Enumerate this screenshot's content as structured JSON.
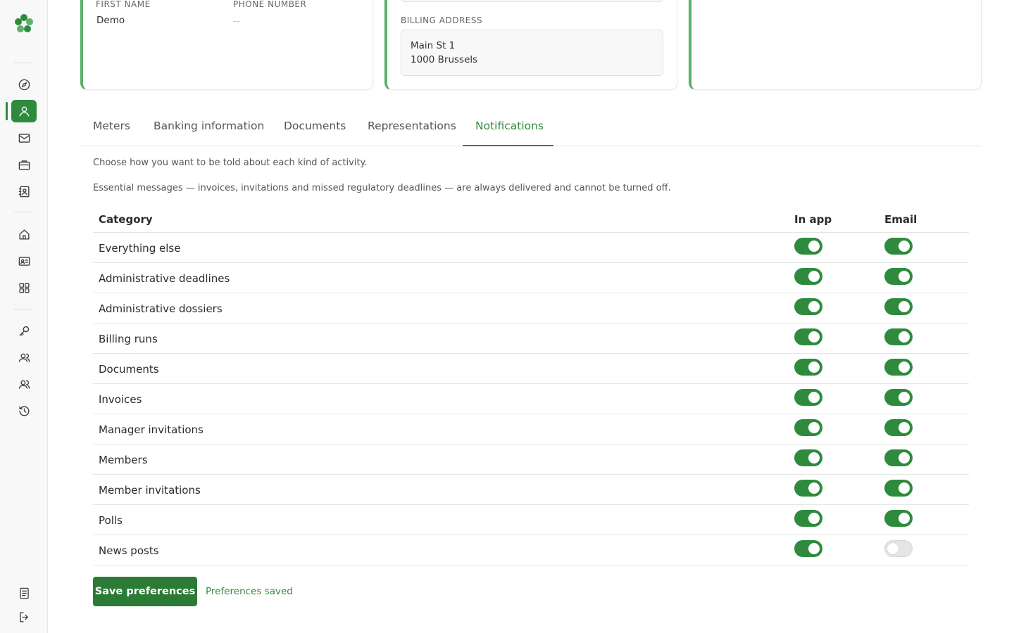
{
  "profile": {
    "first_name_label": "FIRST NAME",
    "first_name": "Demo",
    "phone_label": "PHONE NUMBER",
    "phone": "--"
  },
  "billing": {
    "label": "BILLING ADDRESS",
    "line1": "Main St 1",
    "line2": "1000 Brussels"
  },
  "card3": {
    "text": ""
  },
  "tabs": [
    {
      "label": "Meters"
    },
    {
      "label": "Banking information"
    },
    {
      "label": "Documents"
    },
    {
      "label": "Representations"
    },
    {
      "label": "Notifications",
      "active": true
    }
  ],
  "notifications": {
    "intro": "Choose how you want to be told about each kind of activity.",
    "essential": "Essential messages — invoices, invitations and missed regulatory deadlines — are always delivered and cannot be turned off.",
    "headers": {
      "category": "Category",
      "in_app": "In app",
      "email": "Email"
    },
    "rows": [
      {
        "label": "Everything else",
        "in_app": true,
        "email": true
      },
      {
        "label": "Administrative deadlines",
        "in_app": true,
        "email": true
      },
      {
        "label": "Administrative dossiers",
        "in_app": true,
        "email": true
      },
      {
        "label": "Billing runs",
        "in_app": true,
        "email": true
      },
      {
        "label": "Documents",
        "in_app": true,
        "email": true
      },
      {
        "label": "Invoices",
        "in_app": true,
        "email": true
      },
      {
        "label": "Manager invitations",
        "in_app": true,
        "email": true
      },
      {
        "label": "Members",
        "in_app": true,
        "email": true
      },
      {
        "label": "Member invitations",
        "in_app": true,
        "email": true
      },
      {
        "label": "Polls",
        "in_app": true,
        "email": true
      },
      {
        "label": "News posts",
        "in_app": true,
        "email": false
      }
    ],
    "save_label": "Save preferences",
    "saved_message": "Preferences saved"
  },
  "colors": {
    "accent": "#2e8b3e",
    "accent_dark": "#2b7a35",
    "card_border": "#5cb06a"
  },
  "sidebar": {
    "icons": [
      "compass-icon",
      "user-icon",
      "mail-icon",
      "briefcase-icon",
      "contacts-book-icon",
      "home-icon",
      "id-card-icon",
      "grid-icon",
      "key-icon",
      "users-icon",
      "users-group-icon",
      "history-icon",
      "ledger-icon",
      "logout-icon"
    ]
  }
}
